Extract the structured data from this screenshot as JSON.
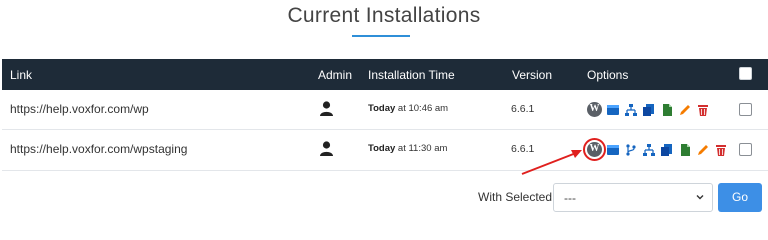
{
  "page": {
    "title": "Current Installations"
  },
  "table": {
    "headers": {
      "link": "Link",
      "admin": "Admin",
      "time": "Installation Time",
      "version": "Version",
      "options": "Options"
    },
    "rows": [
      {
        "link": "https://help.voxfor.com/wp",
        "time_day": "Today",
        "time_rest": " at 10:46 am",
        "version": "6.6.1"
      },
      {
        "link": "https://help.voxfor.com/wpstaging",
        "time_day": "Today",
        "time_rest": " at 11:30 am",
        "version": "6.6.1"
      }
    ]
  },
  "bottom": {
    "with_selected_label": "With Selected:",
    "select_value": "---",
    "go_label": "Go"
  },
  "colors": {
    "header_bg": "#1e2b38",
    "accent": "#2f8fd8",
    "icon_blue": "#1565c0",
    "icon_green": "#2e7d32",
    "icon_orange": "#f57c00",
    "icon_red": "#d32f2f",
    "annotation_red": "#e0201e",
    "go_button": "#3d8fe6"
  },
  "icons": [
    "wordpress-icon",
    "clone-icon",
    "git-branch-icon",
    "sitemap-icon",
    "copy-icon",
    "file-icon",
    "edit-icon",
    "trash-icon"
  ]
}
